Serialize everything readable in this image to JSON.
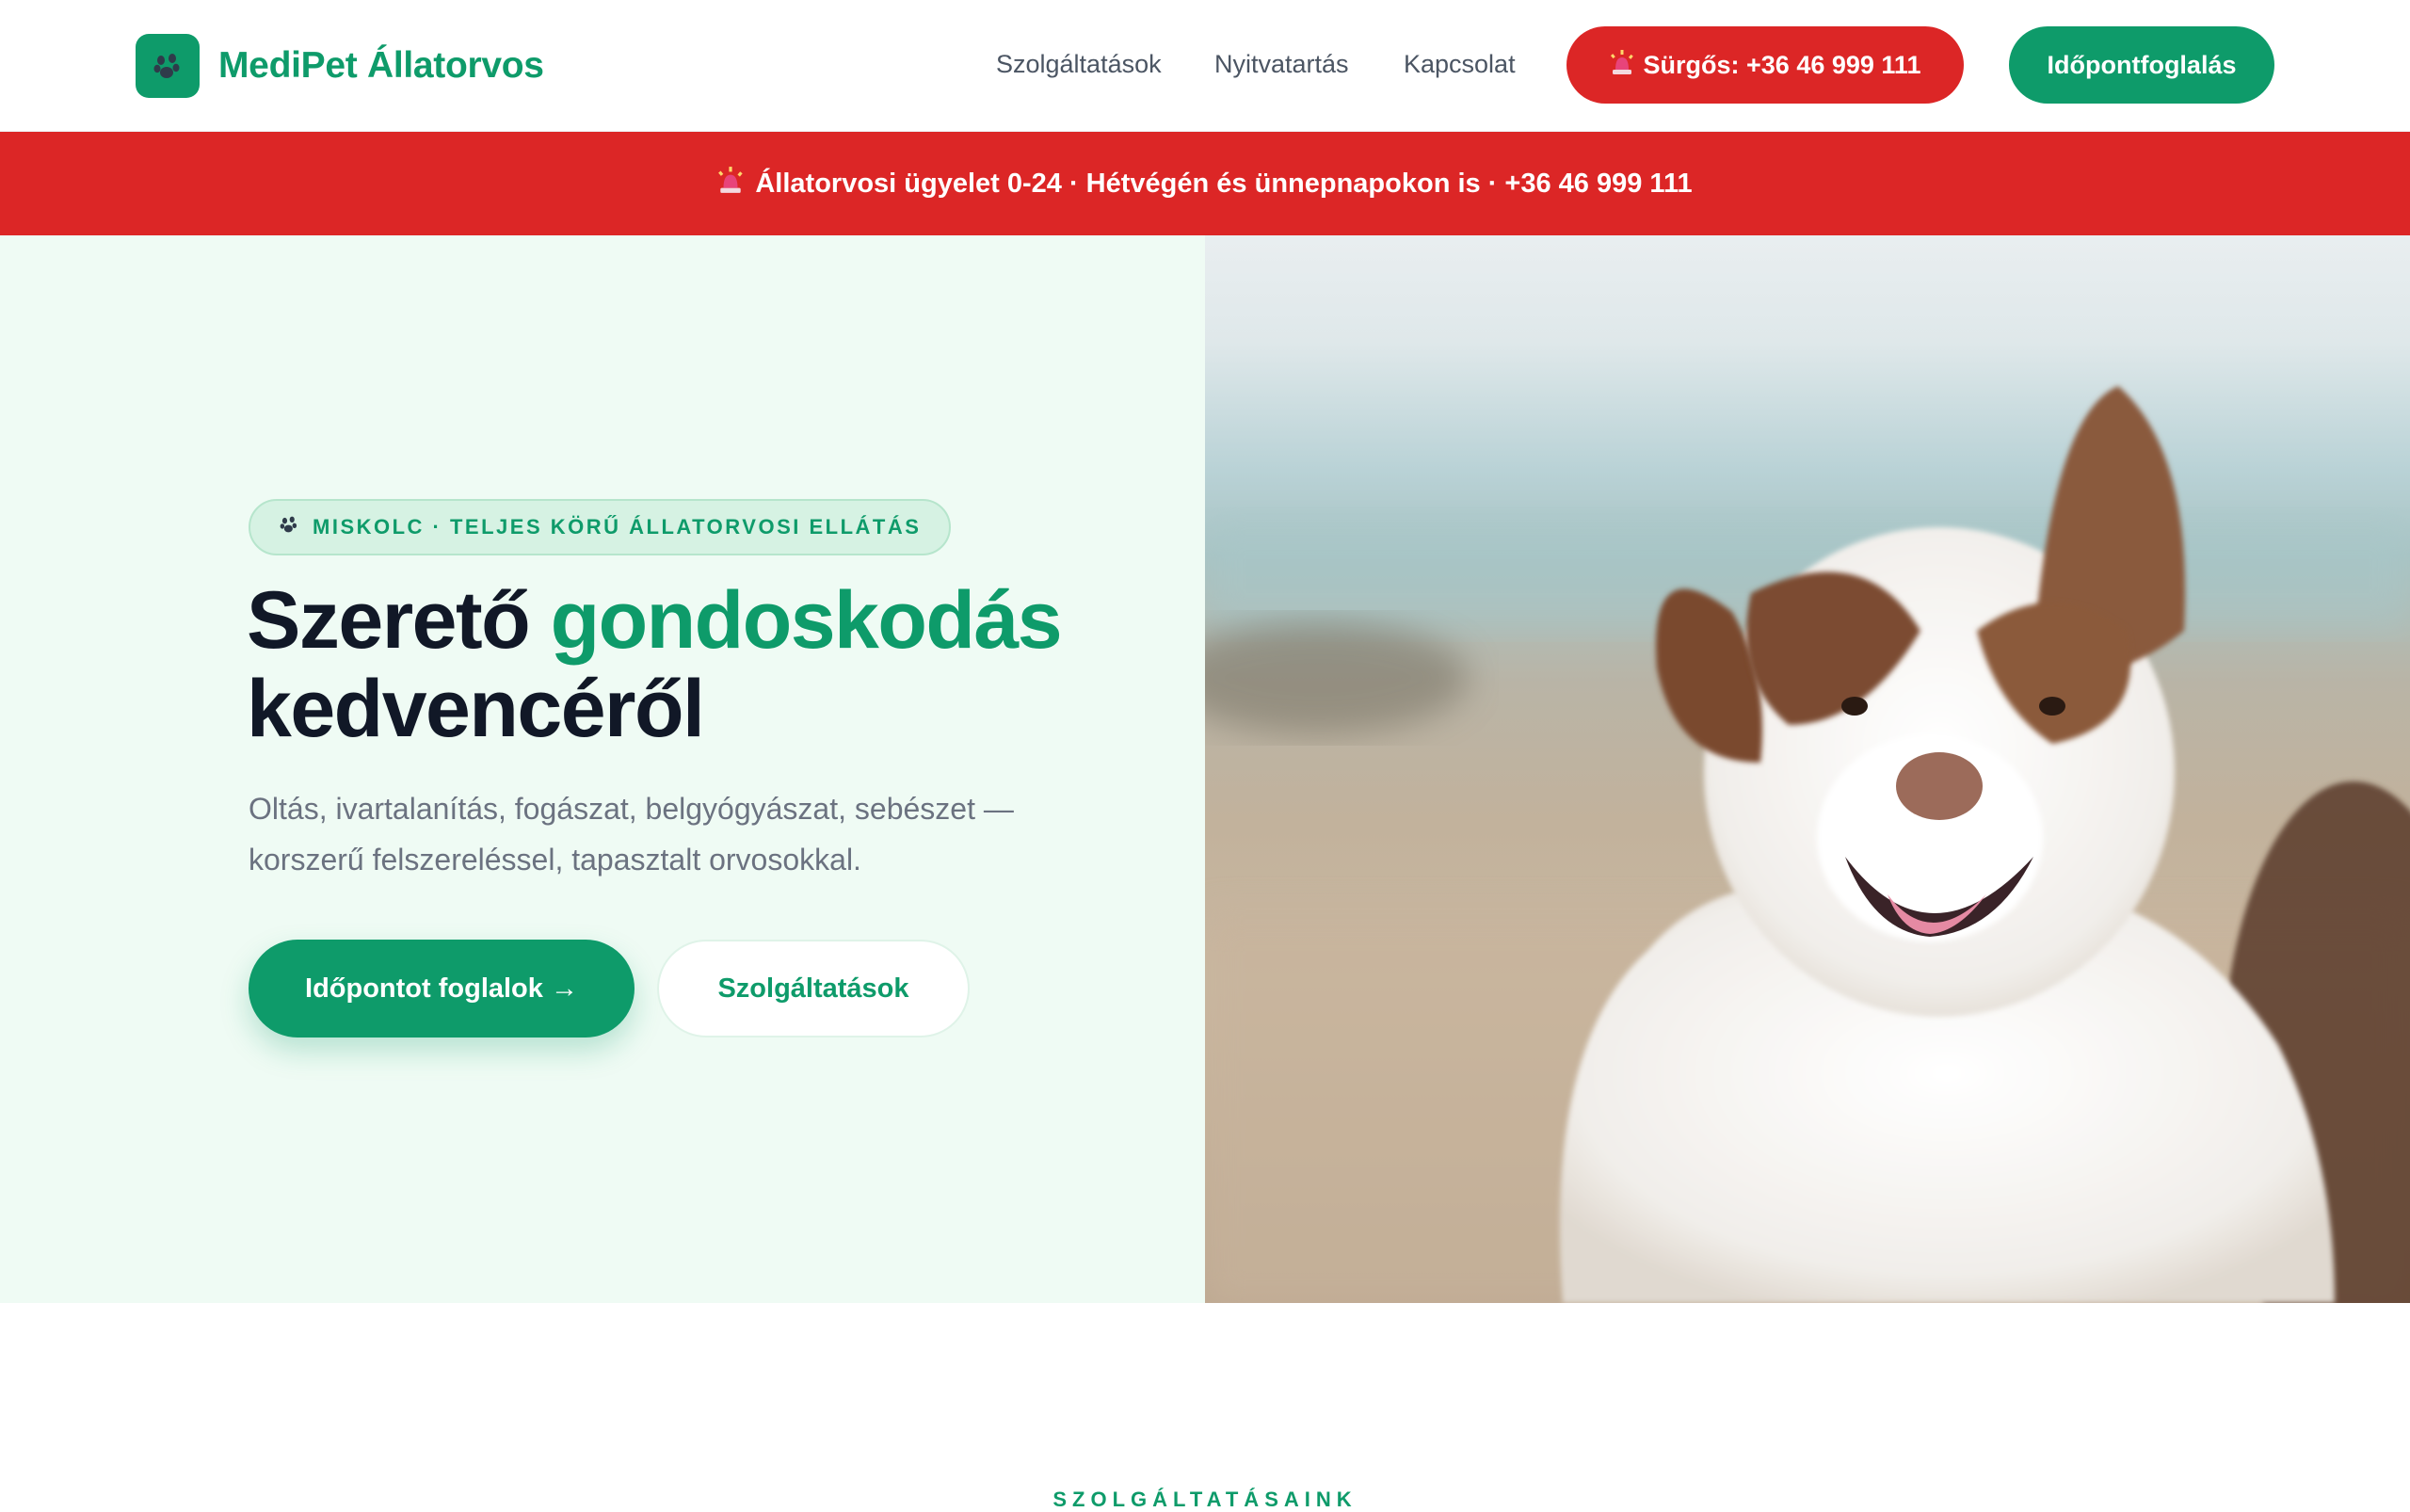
{
  "brand": {
    "name": "MediPet Állatorvos",
    "logo_icon": "paw-icon",
    "color": "#0e9b6a"
  },
  "nav": {
    "links": [
      "Szolgáltatások",
      "Nyitvatartás",
      "Kapcsolat"
    ],
    "urgent_button": "Sürgős: +36 46 999 111",
    "urgent_icon": "siren-icon",
    "book_button": "Időpontfoglalás"
  },
  "alert": {
    "icon": "siren-icon",
    "text": "Állatorvosi ügyelet 0-24 · Hétvégén és ünnepnapokon is · +36 46 999 111",
    "color": "#dc2626"
  },
  "hero": {
    "badge": "MISKOLC · TELJES KÖRŰ ÁLLATORVOSI ELLÁTÁS",
    "badge_icon": "paw-icon",
    "title_part1": "Szerető ",
    "title_accent": "gondoskodás",
    "title_part2": "kedvencéről",
    "subtitle": "Oltás, ivartalanítás, fogászat, belgyógyászat, sebészet — korszerű felszereléssel, tapasztalt orvosokkal.",
    "primary_button": "Időpontot foglalok →",
    "secondary_button": "Szolgáltatások",
    "image": "dog-photo"
  },
  "services": {
    "label": "SZOLGÁLTATÁSAINK"
  }
}
